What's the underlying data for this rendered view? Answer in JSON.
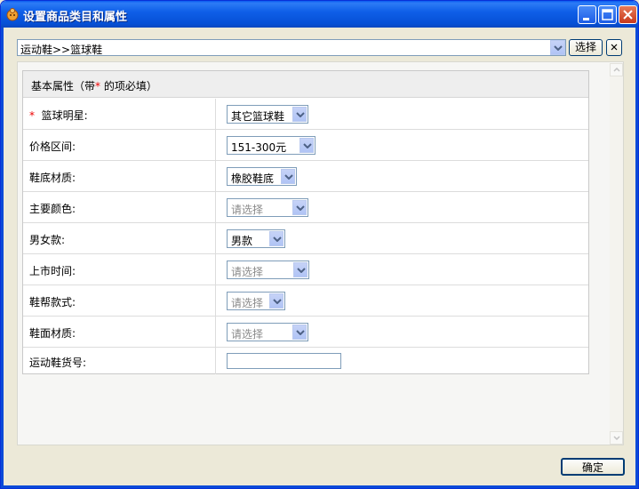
{
  "window": {
    "title": "设置商品类目和属性"
  },
  "category": {
    "value": "运动鞋>>篮球鞋",
    "select_label": "选择"
  },
  "header": {
    "prefix": "基本属性（带",
    "star": "*",
    "suffix": " 的项必填）"
  },
  "required_star": "*",
  "fields": [
    {
      "label": "篮球明星:",
      "value": "其它篮球鞋"
    },
    {
      "label": "价格区间:",
      "value": "151-300元"
    },
    {
      "label": "鞋底材质:",
      "value": "橡胶鞋底"
    },
    {
      "label": "主要颜色:",
      "value": "请选择"
    },
    {
      "label": "男女款:",
      "value": "男款"
    },
    {
      "label": "上市时间:",
      "value": "请选择"
    },
    {
      "label": "鞋帮款式:",
      "value": "请选择"
    },
    {
      "label": "鞋面材质:",
      "value": "请选择"
    },
    {
      "label": "运动鞋货号:",
      "value": ""
    }
  ],
  "ok_label": "确定",
  "colors": {
    "titlebar": "#0a5bf0",
    "required": "#e00000",
    "placeholder": "#8a8a8a"
  }
}
